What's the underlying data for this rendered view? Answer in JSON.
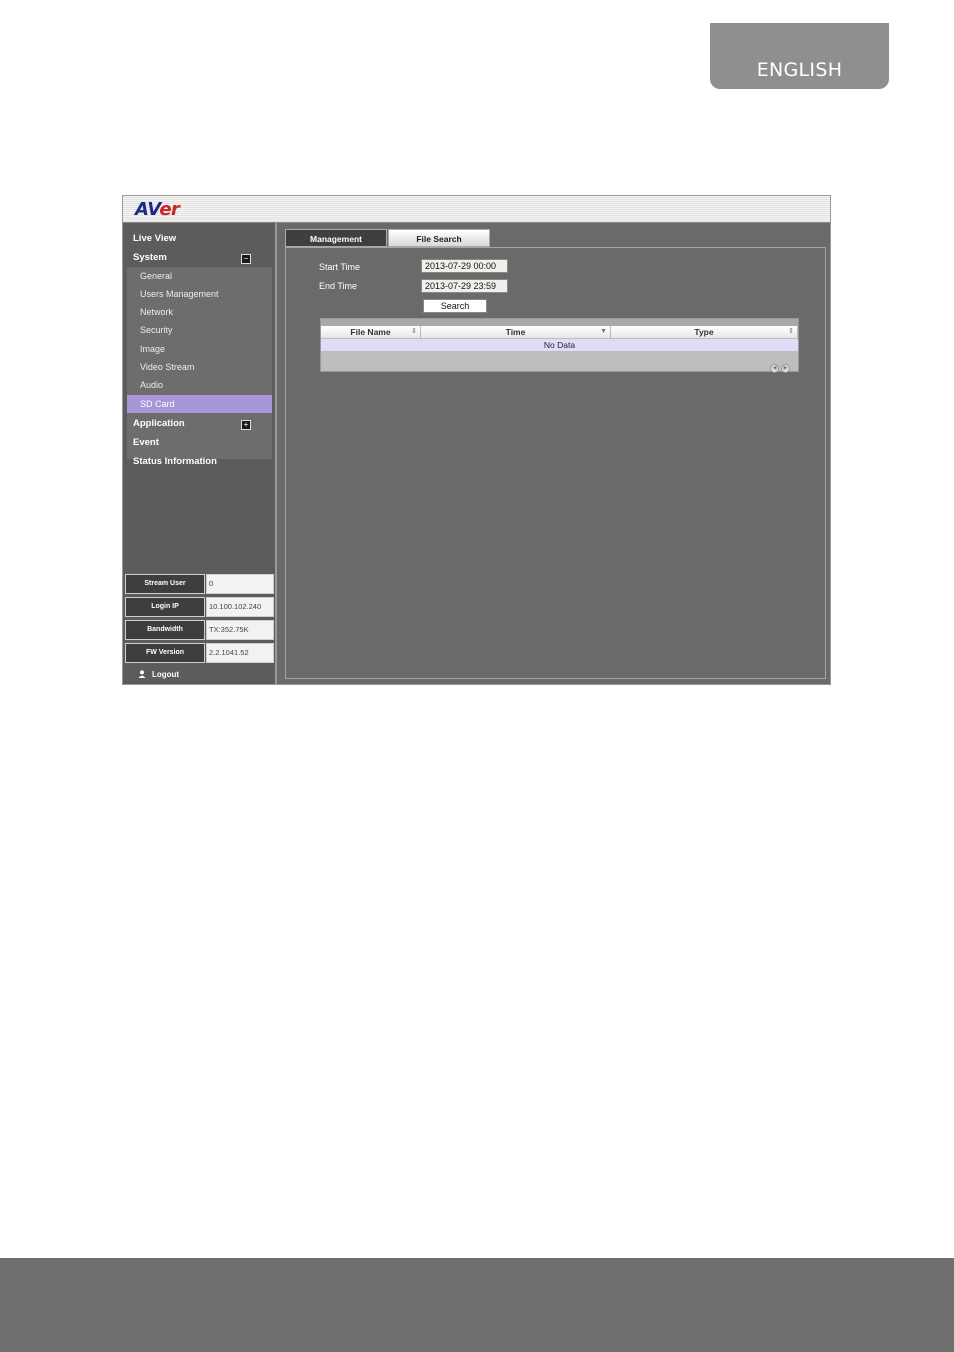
{
  "language_tab": "ENGLISH",
  "app": {
    "logo_a": "AV",
    "logo_b": "er"
  },
  "sidebar": {
    "live_view": "Live View",
    "system": "System",
    "system_toggle": "−",
    "system_items": [
      "General",
      "Users Management",
      "Network",
      "Security",
      "Image",
      "Video Stream",
      "Audio",
      "SD Card"
    ],
    "active_item": "SD Card",
    "application": "Application",
    "application_toggle": "+",
    "event": "Event",
    "status_information": "Status Information",
    "info": [
      {
        "label": "Stream User",
        "value": "0"
      },
      {
        "label": "Login IP",
        "value": "10.100.102.240"
      },
      {
        "label": "Bandwidth",
        "value": "TX:352.75K"
      },
      {
        "label": "FW Version",
        "value": "2.2.1041.52"
      }
    ],
    "logout": "Logout"
  },
  "tabs": {
    "management": "Management",
    "file_search": "File Search"
  },
  "form": {
    "start_time_label": "Start Time",
    "start_time_value": "2013-07-29 00:00",
    "end_time_label": "End Time",
    "end_time_value": "2013-07-29 23:59",
    "search_button": "Search"
  },
  "grid": {
    "columns": [
      "File Name",
      "Time",
      "Type"
    ],
    "empty_text": "No Data"
  }
}
